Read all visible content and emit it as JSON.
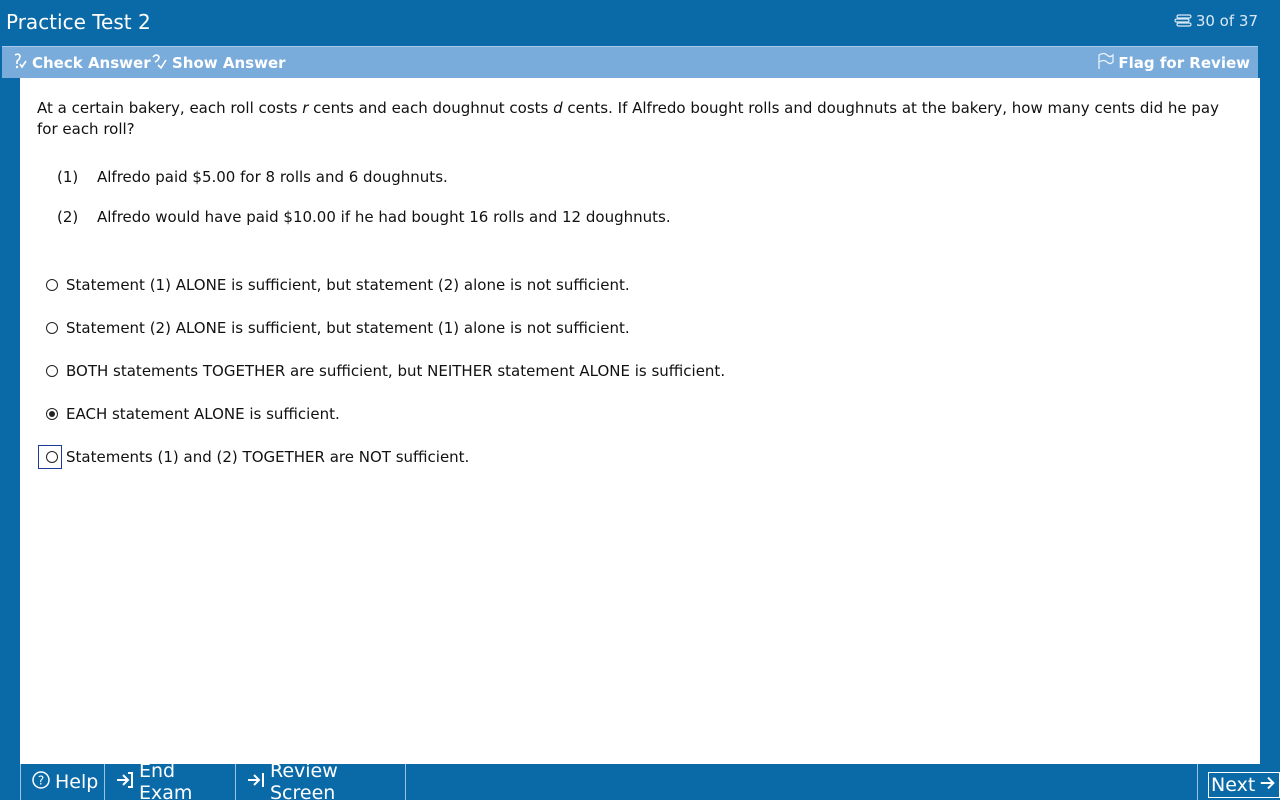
{
  "titlebar": {
    "title": "Practice Test 2",
    "counter": "30 of 37"
  },
  "toolbar": {
    "check_answer": "Check Answer",
    "show_answer": "Show Answer",
    "flag_for_review": "Flag for Review"
  },
  "question": {
    "stem_part1": "At a certain bakery, each roll costs ",
    "var_r": "r",
    "stem_part2": " cents and each doughnut costs ",
    "var_d": "d",
    "stem_part3": " cents.  If Alfredo bought rolls and doughnuts at the bakery, how many cents did he pay for each roll?",
    "statements": [
      {
        "num": "(1)",
        "text": "Alfredo paid $5.00 for 8 rolls and 6 doughnuts."
      },
      {
        "num": "(2)",
        "text": "Alfredo would have paid $10.00 if he had bought 16 rolls and 12 doughnuts."
      }
    ],
    "choices": [
      {
        "text": "Statement (1) ALONE is sufficient, but statement (2) alone is not sufficient.",
        "selected": false
      },
      {
        "text": "Statement (2) ALONE is sufficient, but statement (1) alone is not sufficient.",
        "selected": false
      },
      {
        "text": "BOTH statements TOGETHER are sufficient, but NEITHER statement ALONE is sufficient.",
        "selected": false
      },
      {
        "text": "EACH statement ALONE is sufficient.",
        "selected": true
      },
      {
        "text": "Statements (1) and (2) TOGETHER are NOT sufficient.",
        "selected": false
      }
    ]
  },
  "bottombar": {
    "help": "Help",
    "end_exam": "End Exam",
    "review_screen": "Review Screen",
    "next": "Next"
  },
  "colors": {
    "primary_blue": "#0a6aa8",
    "toolbar_blue": "#7aacdb",
    "content_bg": "#ffffff"
  }
}
